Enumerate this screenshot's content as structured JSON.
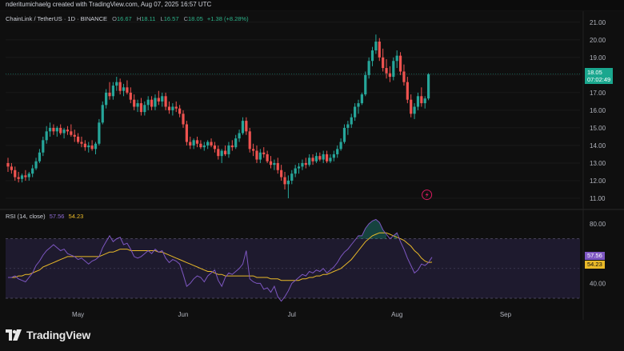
{
  "header": {
    "text": "nderitumichaelg created with TradingView.com, Aug 07, 2025 16:57 UTC"
  },
  "legend": {
    "symbol": "ChainLink / TetherUS · 1D · BINANCE",
    "o_key": "O",
    "o_val": "16.67",
    "h_key": "H",
    "h_val": "18.11",
    "l_key": "L",
    "l_val": "16.57",
    "c_key": "C",
    "c_val": "18.05",
    "change": "+1.38 (+8.28%)"
  },
  "price_tag": {
    "price": "18.05",
    "countdown": "07:02:49"
  },
  "rsi_legend": {
    "title": "RSI (14, close)",
    "rsi": "57.56",
    "ma": "54.23"
  },
  "rsi_tags": {
    "rsi": "57.56",
    "ma": "54.23"
  },
  "brand": {
    "name": "TradingView"
  },
  "colors": {
    "up": "#26a69a",
    "down": "#ef5350",
    "rsi": "#7e57c2",
    "rsi_ma": "#e9b928",
    "band": "#1e1a2e"
  },
  "chart_data": [
    {
      "type": "candlestick",
      "title": "ChainLink / TetherUS · 1D · BINANCE",
      "ylim": [
        10.5,
        21.4
      ],
      "y_ticks": [
        "21.00",
        "20.00",
        "19.00",
        "18.00",
        "17.00",
        "16.00",
        "15.00",
        "14.00",
        "13.00",
        "12.00",
        "11.00"
      ],
      "x_ticks": [
        "May",
        "Jun",
        "Jul",
        "Aug",
        "Sep"
      ],
      "last_price": 18.05,
      "candles": [
        [
          13.0,
          13.3,
          12.5,
          12.8
        ],
        [
          12.8,
          13.0,
          12.4,
          12.6
        ],
        [
          12.6,
          12.8,
          12.0,
          12.2
        ],
        [
          12.2,
          12.5,
          11.9,
          12.1
        ],
        [
          12.1,
          12.4,
          11.9,
          12.3
        ],
        [
          12.3,
          12.6,
          12.0,
          12.2
        ],
        [
          12.2,
          12.5,
          12.0,
          12.4
        ],
        [
          12.4,
          12.9,
          12.2,
          12.7
        ],
        [
          12.7,
          13.3,
          12.6,
          13.1
        ],
        [
          13.1,
          13.8,
          13.0,
          13.6
        ],
        [
          13.6,
          14.5,
          13.4,
          14.3
        ],
        [
          14.3,
          15.1,
          14.1,
          14.8
        ],
        [
          14.8,
          15.3,
          14.5,
          15.0
        ],
        [
          15.0,
          15.2,
          14.6,
          14.8
        ],
        [
          14.8,
          15.1,
          14.5,
          15.0
        ],
        [
          15.0,
          15.2,
          14.6,
          14.7
        ],
        [
          14.7,
          15.0,
          14.4,
          14.9
        ],
        [
          14.9,
          15.1,
          14.6,
          14.8
        ],
        [
          14.8,
          15.2,
          14.5,
          14.6
        ],
        [
          14.6,
          14.9,
          14.2,
          14.5
        ],
        [
          14.5,
          14.7,
          14.1,
          14.2
        ],
        [
          14.2,
          14.5,
          13.9,
          14.1
        ],
        [
          14.1,
          14.3,
          13.7,
          13.9
        ],
        [
          13.9,
          14.2,
          13.6,
          14.0
        ],
        [
          14.0,
          14.3,
          13.7,
          13.8
        ],
        [
          13.8,
          14.2,
          13.5,
          14.1
        ],
        [
          14.1,
          15.5,
          14.0,
          15.3
        ],
        [
          15.3,
          16.5,
          15.2,
          16.3
        ],
        [
          16.3,
          17.2,
          16.1,
          17.0
        ],
        [
          17.0,
          17.6,
          16.6,
          16.8
        ],
        [
          16.8,
          17.6,
          16.6,
          17.4
        ],
        [
          17.4,
          17.9,
          17.1,
          17.6
        ],
        [
          17.6,
          17.8,
          16.9,
          17.1
        ],
        [
          17.1,
          17.5,
          16.8,
          17.3
        ],
        [
          17.3,
          17.7,
          16.9,
          17.0
        ],
        [
          17.0,
          17.3,
          16.4,
          16.6
        ],
        [
          16.6,
          16.9,
          16.0,
          16.2
        ],
        [
          16.2,
          16.6,
          15.9,
          16.4
        ],
        [
          16.4,
          16.7,
          15.7,
          15.9
        ],
        [
          15.9,
          16.5,
          15.7,
          16.3
        ],
        [
          16.3,
          16.8,
          16.0,
          16.6
        ],
        [
          16.6,
          16.8,
          16.0,
          16.2
        ],
        [
          16.2,
          16.9,
          16.0,
          16.7
        ],
        [
          16.7,
          17.1,
          16.3,
          16.5
        ],
        [
          16.5,
          17.0,
          16.2,
          16.8
        ],
        [
          16.8,
          17.0,
          16.0,
          16.2
        ],
        [
          16.2,
          16.5,
          15.8,
          16.0
        ],
        [
          16.0,
          16.4,
          15.7,
          16.2
        ],
        [
          16.2,
          16.5,
          15.9,
          16.1
        ],
        [
          16.1,
          16.3,
          15.6,
          15.8
        ],
        [
          15.8,
          16.0,
          15.0,
          15.2
        ],
        [
          15.2,
          15.4,
          14.0,
          14.2
        ],
        [
          14.2,
          14.5,
          13.8,
          14.0
        ],
        [
          14.0,
          14.4,
          13.8,
          14.3
        ],
        [
          14.3,
          14.5,
          13.9,
          14.1
        ],
        [
          14.1,
          14.3,
          13.8,
          13.9
        ],
        [
          13.9,
          14.2,
          13.7,
          14.0
        ],
        [
          14.0,
          14.3,
          13.8,
          14.2
        ],
        [
          14.2,
          14.4,
          13.9,
          14.0
        ],
        [
          14.0,
          14.2,
          13.6,
          13.8
        ],
        [
          13.8,
          14.0,
          13.2,
          13.4
        ],
        [
          13.4,
          13.8,
          13.0,
          13.7
        ],
        [
          13.7,
          14.0,
          13.4,
          13.5
        ],
        [
          13.5,
          14.2,
          13.3,
          14.0
        ],
        [
          14.0,
          14.3,
          13.7,
          13.9
        ],
        [
          13.9,
          14.6,
          13.8,
          14.4
        ],
        [
          14.4,
          14.9,
          14.2,
          14.7
        ],
        [
          14.7,
          15.6,
          14.6,
          15.4
        ],
        [
          15.4,
          15.6,
          14.6,
          14.8
        ],
        [
          14.8,
          15.0,
          13.6,
          13.8
        ],
        [
          13.8,
          14.1,
          13.4,
          13.7
        ],
        [
          13.7,
          14.0,
          13.0,
          13.2
        ],
        [
          13.2,
          13.8,
          13.0,
          13.6
        ],
        [
          13.6,
          13.9,
          13.3,
          13.5
        ],
        [
          13.5,
          13.7,
          13.0,
          13.1
        ],
        [
          13.1,
          13.4,
          12.7,
          12.9
        ],
        [
          12.9,
          13.2,
          12.6,
          13.0
        ],
        [
          13.0,
          13.3,
          12.4,
          12.6
        ],
        [
          12.6,
          12.9,
          12.0,
          12.2
        ],
        [
          12.2,
          12.5,
          11.5,
          11.8
        ],
        [
          11.8,
          12.3,
          11.0,
          12.0
        ],
        [
          12.0,
          12.6,
          11.8,
          12.4
        ],
        [
          12.4,
          12.9,
          12.2,
          12.7
        ],
        [
          12.7,
          13.0,
          12.4,
          12.8
        ],
        [
          12.8,
          13.2,
          12.6,
          13.0
        ],
        [
          13.0,
          13.3,
          12.7,
          12.9
        ],
        [
          12.9,
          13.5,
          12.8,
          13.3
        ],
        [
          13.3,
          13.5,
          12.9,
          13.1
        ],
        [
          13.1,
          13.6,
          13.0,
          13.4
        ],
        [
          13.4,
          13.6,
          13.1,
          13.2
        ],
        [
          13.2,
          13.7,
          13.0,
          13.5
        ],
        [
          13.5,
          13.7,
          13.0,
          13.1
        ],
        [
          13.1,
          13.5,
          13.0,
          13.3
        ],
        [
          13.3,
          13.7,
          13.1,
          13.5
        ],
        [
          13.5,
          14.0,
          13.3,
          13.8
        ],
        [
          13.8,
          14.4,
          13.7,
          14.2
        ],
        [
          14.2,
          15.2,
          14.1,
          15.0
        ],
        [
          15.0,
          15.4,
          14.6,
          15.2
        ],
        [
          15.2,
          15.8,
          15.0,
          15.6
        ],
        [
          15.6,
          16.4,
          15.4,
          16.2
        ],
        [
          16.2,
          16.6,
          15.8,
          16.4
        ],
        [
          16.4,
          17.0,
          16.3,
          16.9
        ],
        [
          16.9,
          18.2,
          16.8,
          18.0
        ],
        [
          18.0,
          19.0,
          17.8,
          18.8
        ],
        [
          18.8,
          19.6,
          18.5,
          19.4
        ],
        [
          19.4,
          20.3,
          19.2,
          19.9
        ],
        [
          19.9,
          20.1,
          18.8,
          19.0
        ],
        [
          19.0,
          19.5,
          18.2,
          18.4
        ],
        [
          18.4,
          18.9,
          17.8,
          18.1
        ],
        [
          18.1,
          18.5,
          17.6,
          17.9
        ],
        [
          17.9,
          19.0,
          17.7,
          18.8
        ],
        [
          18.8,
          19.4,
          18.4,
          19.1
        ],
        [
          19.1,
          19.3,
          18.0,
          18.2
        ],
        [
          18.2,
          18.6,
          17.4,
          17.6
        ],
        [
          17.6,
          17.9,
          16.4,
          16.6
        ],
        [
          16.6,
          16.9,
          15.6,
          15.8
        ],
        [
          15.8,
          16.4,
          15.5,
          16.2
        ],
        [
          16.2,
          17.0,
          16.0,
          16.8
        ],
        [
          16.8,
          17.3,
          16.2,
          16.4
        ],
        [
          16.4,
          16.8,
          16.1,
          16.67
        ],
        [
          16.67,
          18.11,
          16.57,
          18.05
        ]
      ]
    },
    {
      "type": "line",
      "title": "RSI (14, close)",
      "ylim": [
        23,
        87
      ],
      "y_ticks": [
        "80.00",
        "40.00"
      ],
      "band": [
        30,
        70
      ],
      "series": [
        {
          "name": "RSI",
          "values": [
            44,
            44,
            45,
            43,
            42,
            41,
            44,
            47,
            52,
            55,
            59,
            62,
            64,
            66,
            64,
            62,
            63,
            60,
            59,
            58,
            56,
            57,
            55,
            53,
            55,
            56,
            58,
            64,
            68,
            72,
            68,
            70,
            71,
            66,
            67,
            63,
            58,
            57,
            58,
            60,
            62,
            60,
            63,
            61,
            62,
            57,
            54,
            56,
            55,
            53,
            46,
            38,
            40,
            43,
            45,
            44,
            41,
            45,
            47,
            49,
            42,
            38,
            44,
            47,
            46,
            48,
            50,
            53,
            62,
            43,
            41,
            40,
            40,
            36,
            37,
            34,
            38,
            31,
            28,
            31,
            35,
            40,
            42,
            44,
            46,
            45,
            48,
            47,
            49,
            48,
            50,
            47,
            49,
            51,
            54,
            58,
            61,
            63,
            66,
            69,
            72,
            72,
            77,
            80,
            82,
            83,
            81,
            76,
            73,
            70,
            72,
            74,
            68,
            63,
            57,
            52,
            47,
            49,
            53,
            52,
            54,
            57.56
          ]
        },
        {
          "name": "RSI-based MA",
          "values": [
            44,
            44,
            44,
            45,
            45,
            46,
            46,
            47,
            48,
            49,
            51,
            52,
            53,
            54,
            55,
            56,
            57,
            58,
            58,
            58,
            58,
            58,
            58,
            58,
            58,
            58,
            58,
            59,
            60,
            61,
            61,
            62,
            63,
            63,
            63,
            62,
            62,
            62,
            62,
            62,
            62,
            62,
            62,
            61,
            61,
            60,
            59,
            58,
            57,
            56,
            55,
            54,
            53,
            52,
            51,
            50,
            49,
            48,
            48,
            47,
            46,
            46,
            45,
            45,
            45,
            45,
            45,
            45,
            45,
            45,
            45,
            44,
            44,
            44,
            44,
            43,
            43,
            43,
            42,
            42,
            42,
            42,
            42,
            42,
            43,
            43,
            44,
            44,
            45,
            45,
            46,
            46,
            47,
            48,
            49,
            50,
            52,
            54,
            56,
            59,
            62,
            65,
            68,
            70,
            72,
            73,
            74,
            74,
            74,
            73,
            72,
            71,
            70,
            69,
            67,
            65,
            62,
            60,
            57,
            55,
            54,
            54.23
          ]
        }
      ]
    }
  ]
}
